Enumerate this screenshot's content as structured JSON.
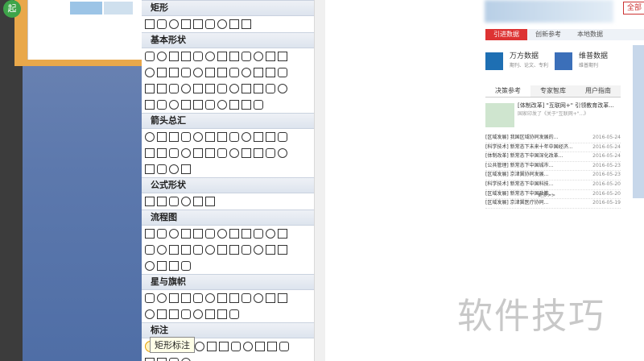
{
  "app": {
    "badge_text": "起"
  },
  "sections": [
    {
      "title": "矩形",
      "rows": [
        9
      ]
    },
    {
      "title": "基本形状",
      "rows": [
        12,
        12,
        12,
        10
      ]
    },
    {
      "title": "箭头总汇",
      "rows": [
        12,
        12,
        4
      ]
    },
    {
      "title": "公式形状",
      "rows": [
        6
      ]
    },
    {
      "title": "流程图",
      "rows": [
        12,
        12,
        4
      ]
    },
    {
      "title": "星与旗帜",
      "rows": [
        12,
        8
      ]
    },
    {
      "title": "标注",
      "rows": [
        12,
        4
      ]
    }
  ],
  "tooltip": "矩形标注",
  "website": {
    "red_label": "全部",
    "tabs": [
      "引进数据",
      "创新参考",
      "本地数据"
    ],
    "databases": [
      {
        "name": "万方数据",
        "sub": "期刊、论文、专利"
      },
      {
        "name": "维普数据",
        "sub": "维普期刊"
      }
    ],
    "news_tabs": [
      "决策参考",
      "专家智库",
      "用户指南"
    ],
    "feature_title": "[体制改革] \"互联网+\" 引领教育改革...",
    "feature_desc": "国家印发了《关于\"互联网+\"...》",
    "news": [
      {
        "title": "[区域发展] 我国区域协同发展的...",
        "date": "2016-05-24"
      },
      {
        "title": "[科学技术] 新常态下未来十年中国经济...",
        "date": "2016-05-24"
      },
      {
        "title": "[体制改革] 新常态下中国深化改革...",
        "date": "2016-05-24"
      },
      {
        "title": "[公共管理] 新常态下中国城市...",
        "date": "2016-05-23"
      },
      {
        "title": "[区域发展] 京津冀协同发展...",
        "date": "2016-05-23"
      },
      {
        "title": "[科学技术] 新常态下中国科技...",
        "date": "2016-05-20"
      },
      {
        "title": "[区域发展] 新常态下中国政策...",
        "date": "2016-05-20"
      },
      {
        "title": "[区域发展] 京津冀医疗协同...",
        "date": "2016-05-19"
      }
    ],
    "more": "更多>>"
  },
  "watermark": "软件技巧"
}
